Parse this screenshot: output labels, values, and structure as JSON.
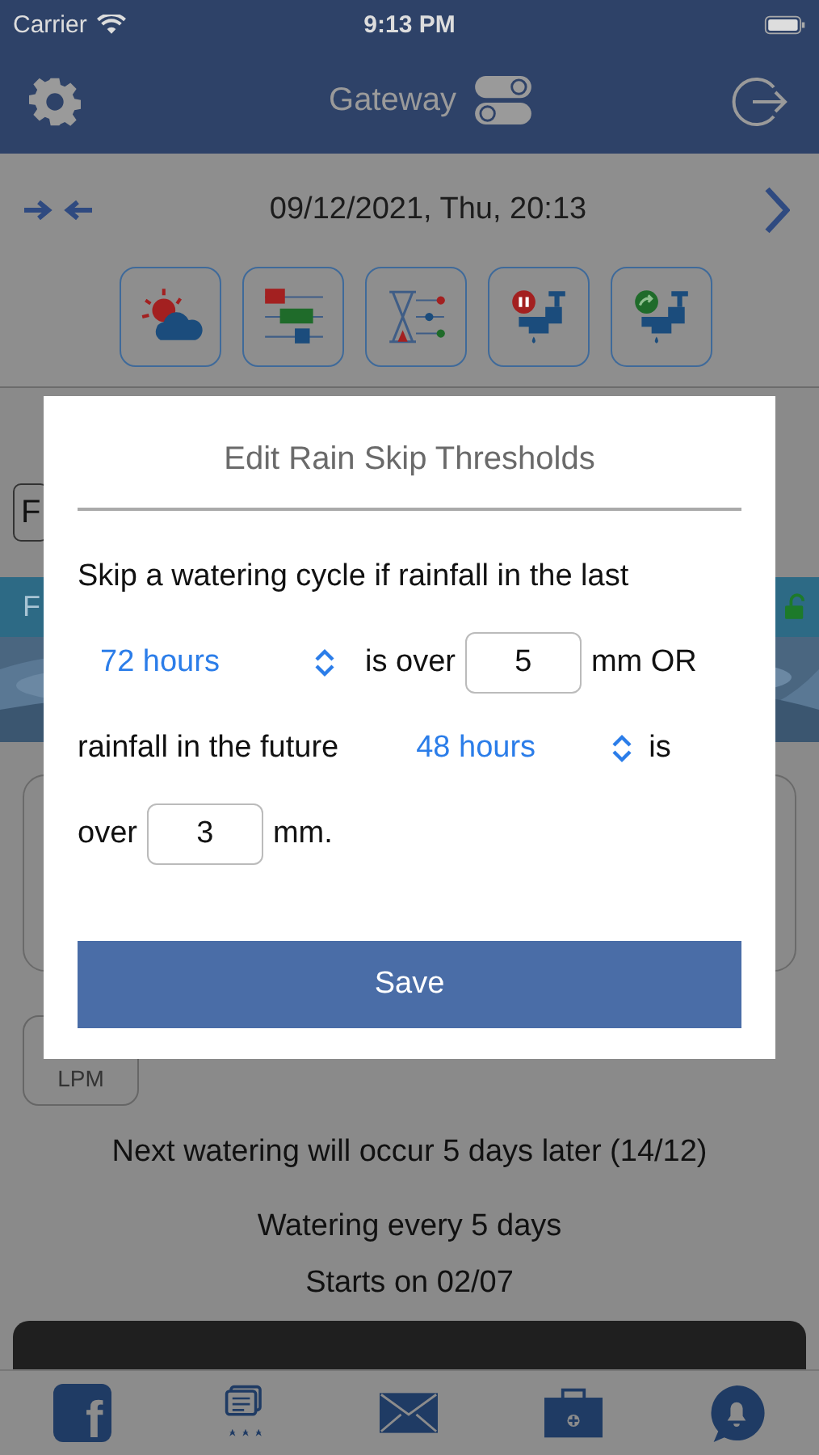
{
  "status_bar": {
    "carrier": "Carrier",
    "time": "9:13 PM"
  },
  "nav": {
    "title": "Gateway"
  },
  "date_bar": {
    "date": "09/12/2021, Thu, 20:13"
  },
  "toolbar": [
    {
      "kind": "weather"
    },
    {
      "kind": "schedule"
    },
    {
      "kind": "timer"
    },
    {
      "kind": "tap-pause"
    },
    {
      "kind": "tap-run"
    }
  ],
  "background": {
    "field_label": "F",
    "banner_label": "F",
    "unit_button": "LPM",
    "next_watering": "Next watering will occur 5 days later (14/12)",
    "schedule": [
      "Watering every 5 days",
      "Starts on 02/07"
    ]
  },
  "dialog": {
    "title": "Edit Rain Skip Thresholds",
    "intro": "Skip a watering cycle if rainfall in the last",
    "past_period": "72 hours",
    "past_text": "is over",
    "past_amount": "5",
    "past_unit": "mm OR",
    "future_text": "rainfall in the future",
    "future_period": "48 hours",
    "future_is": "is",
    "future_over": "over",
    "future_amount": "3",
    "future_unit": "mm.",
    "save": "Save"
  },
  "tab_bar": [
    {
      "kind": "logo",
      "glyph": "f"
    },
    {
      "kind": "reviews"
    },
    {
      "kind": "mail"
    },
    {
      "kind": "kit"
    },
    {
      "kind": "alerts"
    }
  ]
}
